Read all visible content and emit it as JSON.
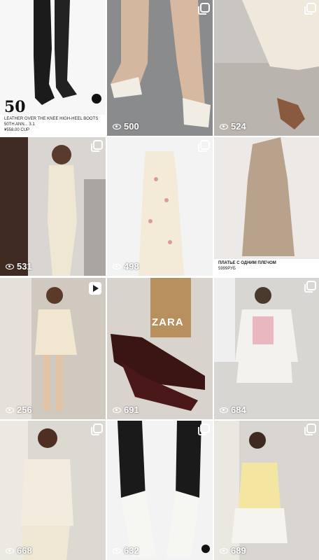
{
  "grid": {
    "tiles": [
      {
        "views": "",
        "caption": "LEATHER OVER THE KNEE HIGH-HEEL BOOTS 50TH ANN... 3.1",
        "price": "¥558.00 CUP",
        "brand_mark": "50",
        "badge": "multi"
      },
      {
        "views": "500",
        "badge": "multi"
      },
      {
        "views": "524",
        "badge": "multi"
      },
      {
        "views": "531",
        "badge": "multi"
      },
      {
        "views": "498",
        "badge": "multi"
      },
      {
        "views": "",
        "caption": "ПЛАТЬЕ С ОДНИМ ПЛЕЧОМ",
        "price": "5999РУБ",
        "badge": "none"
      },
      {
        "views": "256",
        "badge": "play"
      },
      {
        "views": "691",
        "badge": "none",
        "box_text": "ZARA"
      },
      {
        "views": "684",
        "badge": "multi"
      },
      {
        "views": "668",
        "badge": "multi"
      },
      {
        "views": "632",
        "badge": "multi"
      },
      {
        "views": "689",
        "badge": "multi"
      }
    ]
  },
  "colors": {
    "background": "#ffffff",
    "overlay_text": "#ffffff"
  }
}
